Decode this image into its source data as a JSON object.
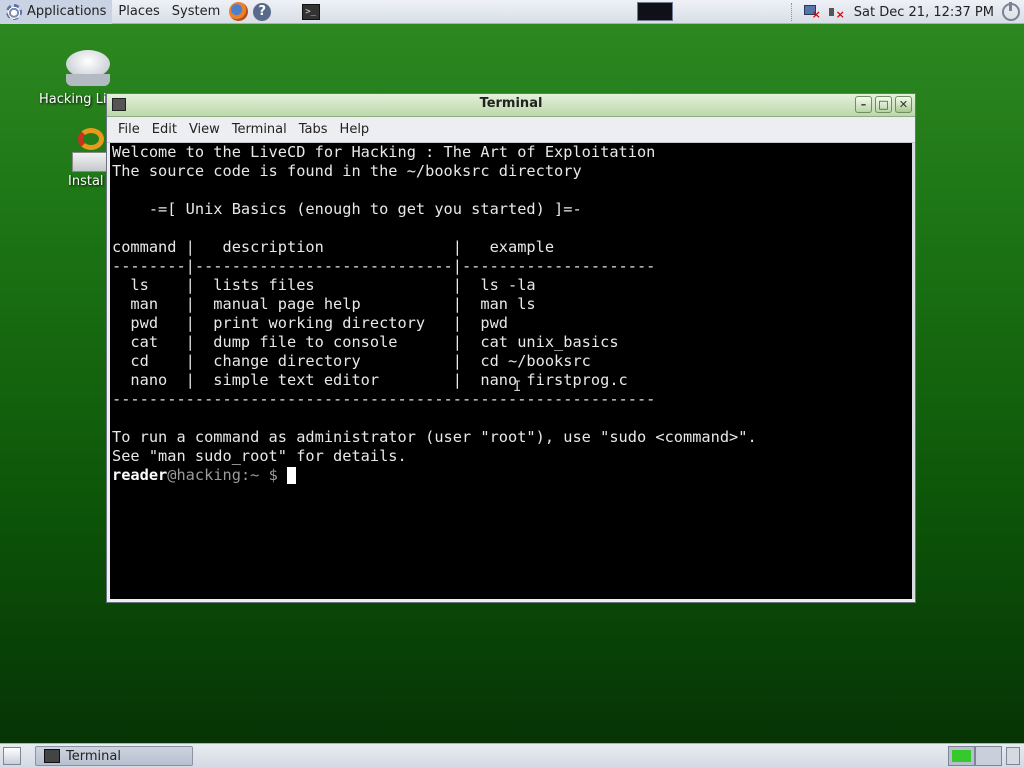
{
  "top_panel": {
    "menus": [
      {
        "label": "Applications"
      },
      {
        "label": "Places"
      },
      {
        "label": "System"
      }
    ],
    "launchers": [
      "firefox-icon",
      "help-icon",
      "terminal-icon"
    ],
    "clock": "Sat Dec 21, 12:37 PM",
    "tray_icons": [
      "network-disconnected-icon",
      "volume-muted-icon",
      "power-icon"
    ]
  },
  "desktop_icons": [
    {
      "label": "Hacking Li",
      "icon": "cd-drive-icon"
    },
    {
      "label": "Instal",
      "icon": "install-icon"
    }
  ],
  "window": {
    "title": "Terminal",
    "menu": [
      {
        "label": "File"
      },
      {
        "label": "Edit"
      },
      {
        "label": "View"
      },
      {
        "label": "Terminal"
      },
      {
        "label": "Tabs"
      },
      {
        "label": "Help"
      }
    ],
    "terminal_text": "Welcome to the LiveCD for Hacking : The Art of Exploitation\nThe source code is found in the ~/booksrc directory\n\n    -=[ Unix Basics (enough to get you started) ]=-\n\ncommand |   description              |   example\n--------|----------------------------|---------------------\n  ls    |  lists files               |  ls -la\n  man   |  manual page help          |  man ls\n  pwd   |  print working directory   |  pwd\n  cat   |  dump file to console      |  cat unix_basics\n  cd    |  change directory          |  cd ~/booksrc\n  nano  |  simple text editor        |  nano firstprog.c\n-----------------------------------------------------------\n\nTo run a command as administrator (user \"root\"), use \"sudo <command>\".\nSee \"man sudo_root\" for details.\n",
    "prompt": {
      "user": "reader",
      "host": "@hacking",
      "path": ":~",
      "symbol": " $ "
    }
  },
  "bottom_panel": {
    "tasks": [
      {
        "label": "Terminal"
      }
    ],
    "workspaces": [
      {
        "active": true
      },
      {
        "active": false
      }
    ]
  },
  "colors": {
    "desktop_top": "#2f8a22",
    "desktop_bottom": "#053004",
    "terminal_bg": "#000000",
    "terminal_fg": "#e8e8e8",
    "titlebar": "#bcd8ab"
  }
}
